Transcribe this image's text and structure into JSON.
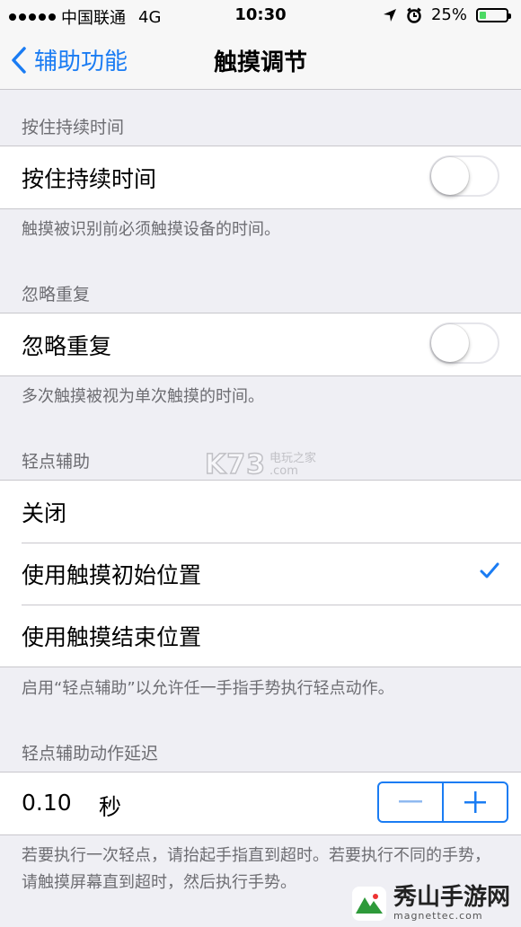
{
  "status_bar": {
    "carrier": "中国联通",
    "network": "4G",
    "time": "10:30",
    "battery": "25%",
    "battery_level": 0.25
  },
  "nav": {
    "back_label": "辅助功能",
    "title": "触摸调节"
  },
  "hold_duration": {
    "header": "按住持续时间",
    "label": "按住持续时间",
    "enabled": false,
    "footer": "触摸被识别前必须触摸设备的时间。"
  },
  "ignore_repeat": {
    "header": "忽略重复",
    "label": "忽略重复",
    "enabled": false,
    "footer": "多次触摸被视为单次触摸的时间。"
  },
  "tap_assistance": {
    "header": "轻点辅助",
    "options": [
      "关闭",
      "使用触摸初始位置",
      "使用触摸结束位置"
    ],
    "selected": "使用触摸初始位置",
    "footer": "启用“轻点辅助”以允许任一手指手势执行轻点动作。"
  },
  "gesture_delay": {
    "header": "轻点辅助动作延迟",
    "value": "0.10",
    "unit": "秒",
    "footer": "若要执行一次轻点，请抬起手指直到超时。若要执行不同的手势，请触摸屏幕直到超时，然后执行手势。"
  },
  "watermarks": {
    "k73_logo": "K73",
    "k73_text": "电玩之家",
    "k73_domain": ".com",
    "site_title": "秀山手游网",
    "site_domain": "magnettec.com"
  },
  "colors": {
    "accent": "#1a7cf3",
    "background": "#efeff4",
    "separator": "#c8c7cc",
    "secondary_text": "#6d6d72"
  },
  "icons": {
    "back": "chevron-left-icon",
    "selected": "checkmark-icon",
    "decrement": "minus-icon",
    "increment": "plus-icon"
  }
}
